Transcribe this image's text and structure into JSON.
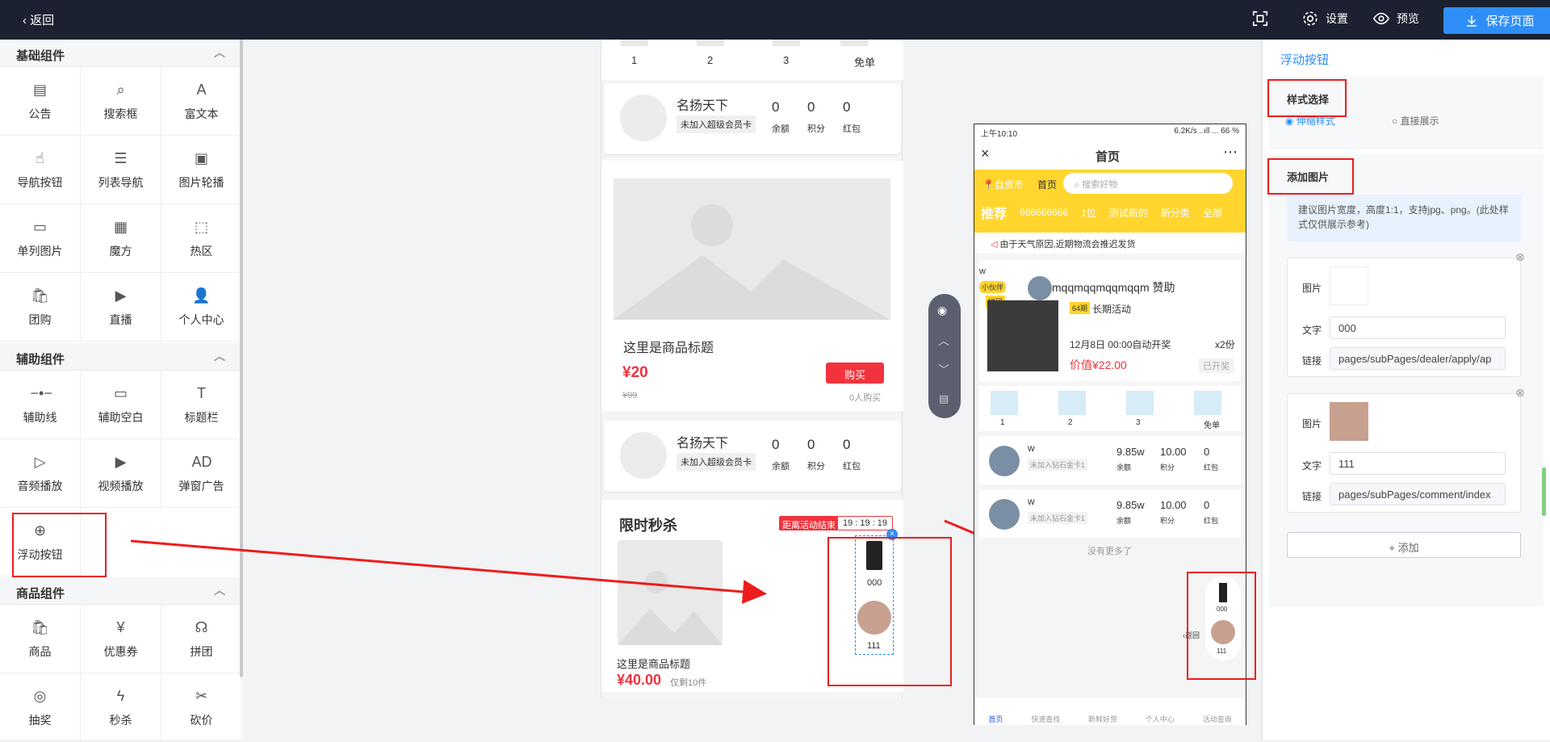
{
  "topbar": {
    "back": "返回",
    "settings": "设置",
    "preview": "预览",
    "save": "保存页面"
  },
  "left": {
    "sections": [
      {
        "title": "基础组件",
        "items": [
          "公告",
          "搜索框",
          "富文本",
          "导航按钮",
          "列表导航",
          "图片轮播",
          "单列图片",
          "魔方",
          "热区",
          "团购",
          "直播",
          "个人中心"
        ]
      },
      {
        "title": "辅助组件",
        "items": [
          "辅助线",
          "辅助空白",
          "标题栏",
          "音频播放",
          "视频播放",
          "弹窗广告",
          "浮动按钮"
        ]
      },
      {
        "title": "商品组件",
        "items": [
          "商品",
          "优惠券",
          "拼团",
          "抽奖",
          "秒杀",
          "砍价"
        ]
      }
    ]
  },
  "phone1": {
    "tabs": [
      "1",
      "2",
      "3",
      "免单"
    ],
    "member": {
      "name": "名扬天下",
      "badge": "未加入超级会员卡",
      "stats": [
        {
          "v": "0",
          "l": "余额"
        },
        {
          "v": "0",
          "l": "积分"
        },
        {
          "v": "0",
          "l": "红包"
        }
      ]
    },
    "product": {
      "title": "这里是商品标题",
      "price": "¥20",
      "buy": "购买",
      "old": "¥99",
      "sold": "0人购买"
    },
    "seckill": {
      "title": "限时秒杀",
      "ends": "距离活动结束",
      "time": "19 : 19 : 19",
      "ptitle": "这里是商品标题",
      "price": "¥40.00",
      "left": "仅剩10件"
    },
    "float": [
      "000",
      "111"
    ]
  },
  "phone2": {
    "status": {
      "time": "上午10:10",
      "right": "6.2K/s ..ıll ... 66 %"
    },
    "title": "首页",
    "city": "自贡市",
    "home": "首页",
    "search": "搜索好物",
    "cats": [
      "推荐",
      "666666666",
      "1位",
      "测试新的",
      "新分类",
      "全部"
    ],
    "notice": "由于天气原因,近期物流会推迟发货",
    "sponsor": "mqqmqqmqqmqqm 赞助",
    "w": "w",
    "partner": "小伙伴",
    "tag": "拼团",
    "activity": {
      "days": "64期",
      "name": "长期活动",
      "date": "12月8日 00:00自动开奖",
      "share": "x2份",
      "price": "价值¥22.00",
      "status": "已开奖"
    },
    "nav": [
      "1",
      "2",
      "3",
      "免单"
    ],
    "users": [
      {
        "name": "w",
        "card": "未加入钻石金卡1",
        "stats": [
          {
            "v": "9.85w",
            "l": "余额"
          },
          {
            "v": "10.00",
            "l": "积分"
          },
          {
            "v": "0",
            "l": "红包"
          }
        ]
      },
      {
        "name": "w",
        "card": "未加入钻石金卡1",
        "stats": [
          {
            "v": "9.85w",
            "l": "余额"
          },
          {
            "v": "10.00",
            "l": "积分"
          },
          {
            "v": "0",
            "l": "红包"
          }
        ]
      }
    ],
    "more": "没有更多了",
    "float": [
      "000",
      "111"
    ],
    "back": "返回",
    "tabbar": [
      "首页",
      "快速查找",
      "新鲜好货",
      "个人中心",
      "活动查询"
    ]
  },
  "rpanel": {
    "title": "浮动按钮",
    "style_label": "样式选择",
    "style_opts": [
      "伸缩样式",
      "直接展示"
    ],
    "add_label": "添加图片",
    "hint": "建议图片宽度，高度1:1，支持jpg、png。(此处样式仅供展示参考)",
    "items": [
      {
        "img": "图片",
        "text_label": "文字",
        "text": "000",
        "link_label": "链接",
        "link": "pages/subPages/dealer/apply/ap"
      },
      {
        "img": "图片",
        "text_label": "文字",
        "text": "111",
        "link_label": "链接",
        "link": "pages/subPages/comment/index"
      }
    ],
    "add_btn": "+ 添加"
  },
  "colors": {
    "accent": "#2f8ef7",
    "red": "#f2333d",
    "yellow": "#ffd52e",
    "dark": "#1b2130"
  }
}
